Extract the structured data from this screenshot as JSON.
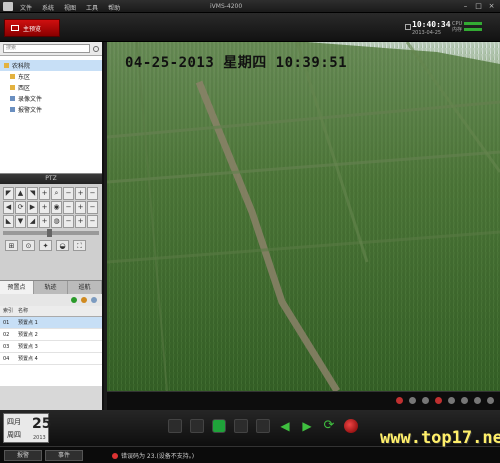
{
  "titlebar": {
    "menu": [
      "文件",
      "系统",
      "视图",
      "工具",
      "帮助"
    ],
    "app_title": "iVMS-4200"
  },
  "toolbar": {
    "main_tab": "主预览",
    "clock_time": "10:40:34",
    "clock_date": "2013-04-25",
    "meter_cpu": "CPU",
    "meter_mem": "内存"
  },
  "left_panel": {
    "search_placeholder": "搜索",
    "tree": [
      {
        "label": "农科院",
        "kind": "folder"
      },
      {
        "label": "东区",
        "kind": "folder"
      },
      {
        "label": "西区",
        "kind": "folder"
      },
      {
        "label": "录像文件",
        "kind": "file"
      },
      {
        "label": "报警文件",
        "kind": "file"
      }
    ],
    "ptz_title": "PTZ",
    "ptz_tabs": [
      "预置点",
      "轨迹",
      "巡航"
    ],
    "preset_headers": [
      "索引",
      "名称"
    ],
    "presets": [
      {
        "idx": "01",
        "name": "预置点 1"
      },
      {
        "idx": "02",
        "name": "预置点 2"
      },
      {
        "idx": "03",
        "name": "预置点 3"
      },
      {
        "idx": "04",
        "name": "预置点 4"
      }
    ]
  },
  "video": {
    "osd": "04-25-2013  星期四  10:39:51"
  },
  "bottom": {
    "month": "四月",
    "week": "周四",
    "day": "25",
    "year": "2013"
  },
  "statusbar": {
    "tab_alarm": "报警",
    "tab_event": "事件",
    "message": "错误码为 23.(设备不支持。)"
  },
  "watermark": "www.top17.net"
}
